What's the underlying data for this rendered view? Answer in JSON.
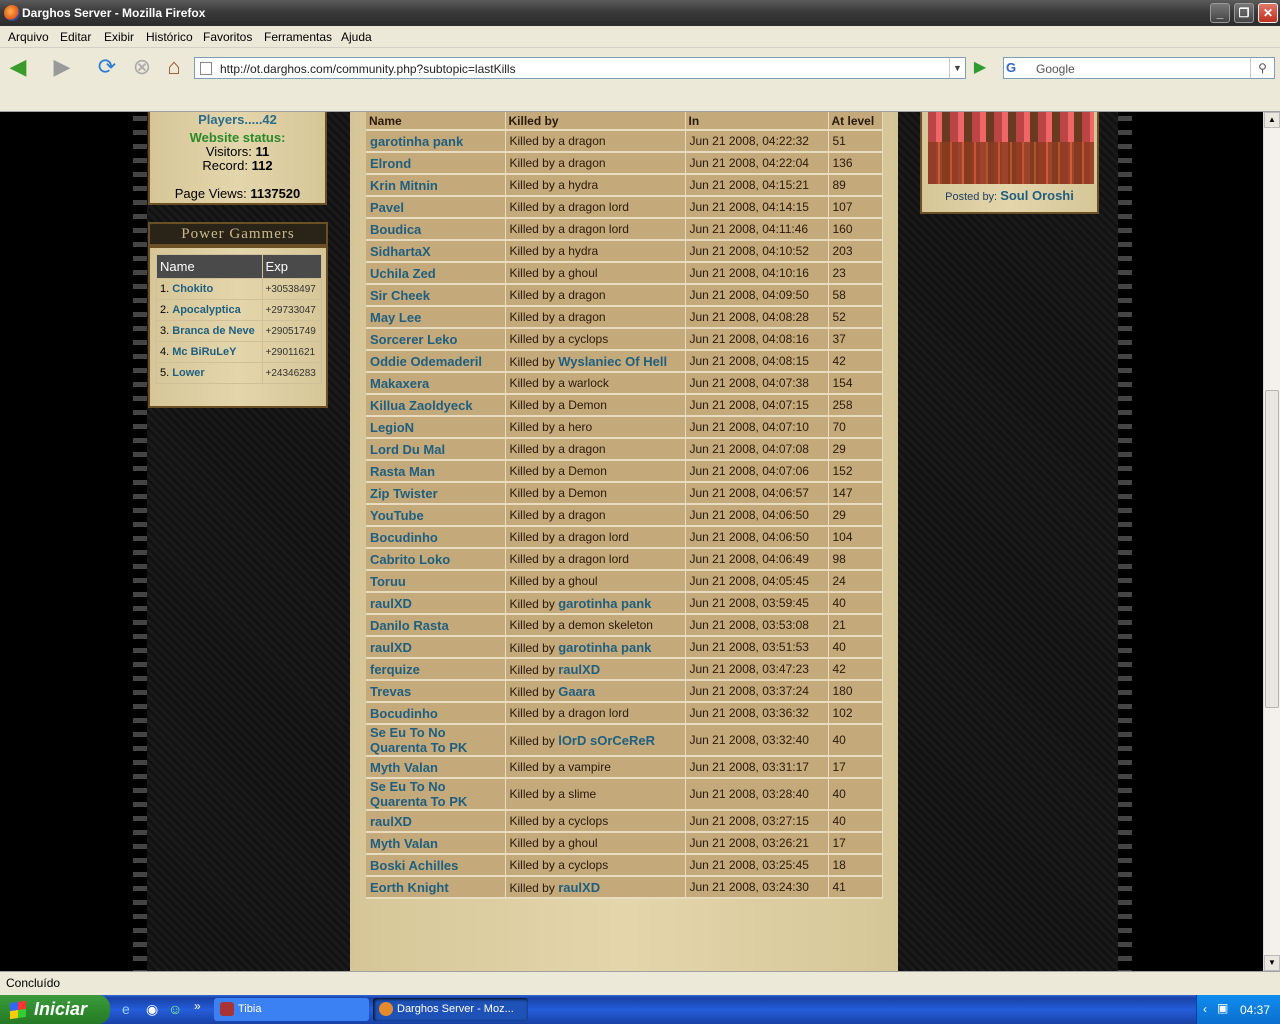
{
  "window": {
    "title": "Darghos Server - Mozilla Firefox"
  },
  "menu": [
    "Arquivo",
    "Editar",
    "Exibir",
    "Histórico",
    "Favoritos",
    "Ferramentas",
    "Ajuda"
  ],
  "address": {
    "url": "http://ot.darghos.com/community.php?subtopic=lastKills"
  },
  "search": {
    "engine": "G",
    "placeholder": "Google"
  },
  "sidebar": {
    "players": "Players.....42",
    "website_status": "Website status:",
    "visitors_label": "Visitors:",
    "visitors": "11",
    "record_label": "Record:",
    "record": "112",
    "pageviews_label": "Page Views:",
    "pageviews": "1137520",
    "power_gamers_title": "Power Gammers",
    "pg_headers": {
      "name": "Name",
      "exp": "Exp"
    },
    "power_gamers": [
      {
        "rank": "1.",
        "name": "Chokito",
        "exp": "+30538497"
      },
      {
        "rank": "2.",
        "name": "Apocalyptica",
        "exp": "+29733047"
      },
      {
        "rank": "3.",
        "name": "Branca de Neve",
        "exp": "+29051749"
      },
      {
        "rank": "4.",
        "name": "Mc BiRuLeY",
        "exp": "+29011621"
      },
      {
        "rank": "5.",
        "name": "Lower",
        "exp": "+24346283"
      }
    ]
  },
  "kills_headers": {
    "name": "Name",
    "killed_by": "Killed by",
    "in": "In",
    "level": "At level"
  },
  "kills": [
    {
      "name": "garotinha pank",
      "prefix": "Killed by a dragon",
      "killer": "",
      "date": "Jun 21 2008, 04:22:32",
      "level": "51"
    },
    {
      "name": "Elrond",
      "prefix": "Killed by a dragon",
      "killer": "",
      "date": "Jun 21 2008, 04:22:04",
      "level": "136"
    },
    {
      "name": "Krin Mitnin",
      "prefix": "Killed by a hydra",
      "killer": "",
      "date": "Jun 21 2008, 04:15:21",
      "level": "89"
    },
    {
      "name": "Pavel",
      "prefix": "Killed by a dragon lord",
      "killer": "",
      "date": "Jun 21 2008, 04:14:15",
      "level": "107"
    },
    {
      "name": "Boudica",
      "prefix": "Killed by a dragon lord",
      "killer": "",
      "date": "Jun 21 2008, 04:11:46",
      "level": "160"
    },
    {
      "name": "SidhartaX",
      "prefix": "Killed by a hydra",
      "killer": "",
      "date": "Jun 21 2008, 04:10:52",
      "level": "203"
    },
    {
      "name": "Uchila Zed",
      "prefix": "Killed by a ghoul",
      "killer": "",
      "date": "Jun 21 2008, 04:10:16",
      "level": "23"
    },
    {
      "name": "Sir Cheek",
      "prefix": "Killed by a dragon",
      "killer": "",
      "date": "Jun 21 2008, 04:09:50",
      "level": "58"
    },
    {
      "name": "May Lee",
      "prefix": "Killed by a dragon",
      "killer": "",
      "date": "Jun 21 2008, 04:08:28",
      "level": "52"
    },
    {
      "name": "Sorcerer Leko",
      "prefix": "Killed by a cyclops",
      "killer": "",
      "date": "Jun 21 2008, 04:08:16",
      "level": "37"
    },
    {
      "name": "Oddie Odemaderil",
      "prefix": "Killed by",
      "killer": "Wyslaniec Of Hell",
      "date": "Jun 21 2008, 04:08:15",
      "level": "42"
    },
    {
      "name": "Makaxera",
      "prefix": "Killed by a warlock",
      "killer": "",
      "date": "Jun 21 2008, 04:07:38",
      "level": "154"
    },
    {
      "name": "Killua Zaoldyeck",
      "prefix": "Killed by a Demon",
      "killer": "",
      "date": "Jun 21 2008, 04:07:15",
      "level": "258"
    },
    {
      "name": "LegioN",
      "prefix": "Killed by a hero",
      "killer": "",
      "date": "Jun 21 2008, 04:07:10",
      "level": "70"
    },
    {
      "name": "Lord Du Mal",
      "prefix": "Killed by a dragon",
      "killer": "",
      "date": "Jun 21 2008, 04:07:08",
      "level": "29"
    },
    {
      "name": "Rasta Man",
      "prefix": "Killed by a Demon",
      "killer": "",
      "date": "Jun 21 2008, 04:07:06",
      "level": "152"
    },
    {
      "name": "Zip Twister",
      "prefix": "Killed by a Demon",
      "killer": "",
      "date": "Jun 21 2008, 04:06:57",
      "level": "147"
    },
    {
      "name": "YouTube",
      "prefix": "Killed by a dragon",
      "killer": "",
      "date": "Jun 21 2008, 04:06:50",
      "level": "29"
    },
    {
      "name": "Bocudinho",
      "prefix": "Killed by a dragon lord",
      "killer": "",
      "date": "Jun 21 2008, 04:06:50",
      "level": "104"
    },
    {
      "name": "Cabrito Loko",
      "prefix": "Killed by a dragon lord",
      "killer": "",
      "date": "Jun 21 2008, 04:06:49",
      "level": "98"
    },
    {
      "name": "Toruu",
      "prefix": "Killed by a ghoul",
      "killer": "",
      "date": "Jun 21 2008, 04:05:45",
      "level": "24"
    },
    {
      "name": "raulXD",
      "prefix": "Killed by",
      "killer": "garotinha pank",
      "date": "Jun 21 2008, 03:59:45",
      "level": "40"
    },
    {
      "name": "Danilo Rasta",
      "prefix": "Killed by a demon skeleton",
      "killer": "",
      "date": "Jun 21 2008, 03:53:08",
      "level": "21"
    },
    {
      "name": "raulXD",
      "prefix": "Killed by",
      "killer": "garotinha pank",
      "date": "Jun 21 2008, 03:51:53",
      "level": "40"
    },
    {
      "name": "ferquize",
      "prefix": "Killed by",
      "killer": "raulXD",
      "date": "Jun 21 2008, 03:47:23",
      "level": "42"
    },
    {
      "name": "Trevas",
      "prefix": "Killed by",
      "killer": "Gaara",
      "date": "Jun 21 2008, 03:37:24",
      "level": "180"
    },
    {
      "name": "Bocudinho",
      "prefix": "Killed by a dragon lord",
      "killer": "",
      "date": "Jun 21 2008, 03:36:32",
      "level": "102"
    },
    {
      "name": "Se Eu To No Quarenta To PK",
      "prefix": "Killed by",
      "killer": "lOrD sOrCeReR",
      "date": "Jun 21 2008, 03:32:40",
      "level": "40"
    },
    {
      "name": "Myth Valan",
      "prefix": "Killed by a vampire",
      "killer": "",
      "date": "Jun 21 2008, 03:31:17",
      "level": "17"
    },
    {
      "name": "Se Eu To No Quarenta To PK",
      "prefix": "Killed by a slime",
      "killer": "",
      "date": "Jun 21 2008, 03:28:40",
      "level": "40"
    },
    {
      "name": "raulXD",
      "prefix": "Killed by a cyclops",
      "killer": "",
      "date": "Jun 21 2008, 03:27:15",
      "level": "40"
    },
    {
      "name": "Myth Valan",
      "prefix": "Killed by a ghoul",
      "killer": "",
      "date": "Jun 21 2008, 03:26:21",
      "level": "17"
    },
    {
      "name": "Boski Achilles",
      "prefix": "Killed by a cyclops",
      "killer": "",
      "date": "Jun 21 2008, 03:25:45",
      "level": "18"
    },
    {
      "name": "Eorth Knight",
      "prefix": "Killed by",
      "killer": "raulXD",
      "date": "Jun 21 2008, 03:24:30",
      "level": "41"
    }
  ],
  "news": {
    "posted_by_label": "Posted by:",
    "author": "Soul Oroshi"
  },
  "status": {
    "text": "Concluído"
  },
  "taskbar": {
    "start": "Iniciar",
    "items": [
      "Tibia",
      "Darghos Server - Moz..."
    ],
    "clock": "04:37"
  }
}
